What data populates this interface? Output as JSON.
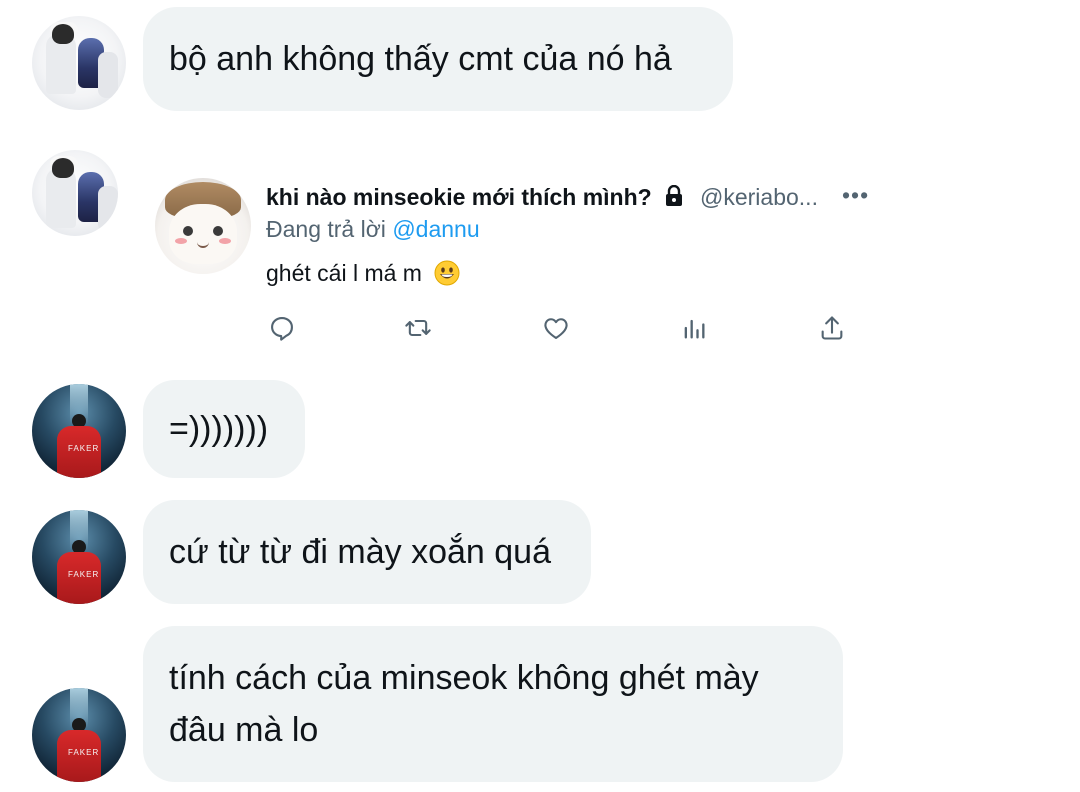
{
  "messages": [
    {
      "text": "bộ anh không thấy cmt của nó hả"
    },
    {
      "text": "=)))))))"
    },
    {
      "text": "cứ từ từ đi mày xoắn quá"
    },
    {
      "text_line1": "tính cách của minseok không ghét mày",
      "text_line2": "đâu mà lo"
    }
  ],
  "avatar_text": "FAKER",
  "quoted_tweet": {
    "display_name": "khi nào minseokie mới thích mình?",
    "handle": "@keriabo...",
    "more": "•••",
    "replying_prefix": "Đang trả lời",
    "replying_to": "@dannu",
    "text": "ghét cái l má m",
    "emoji": "grinning-face-emoji"
  },
  "actions": [
    "reply-icon",
    "retweet-icon",
    "like-icon",
    "analytics-icon",
    "share-icon"
  ],
  "colors": {
    "bubble": "#eff3f4",
    "text": "#0f1419",
    "secondary": "#536471",
    "link": "#1d9bf0"
  }
}
